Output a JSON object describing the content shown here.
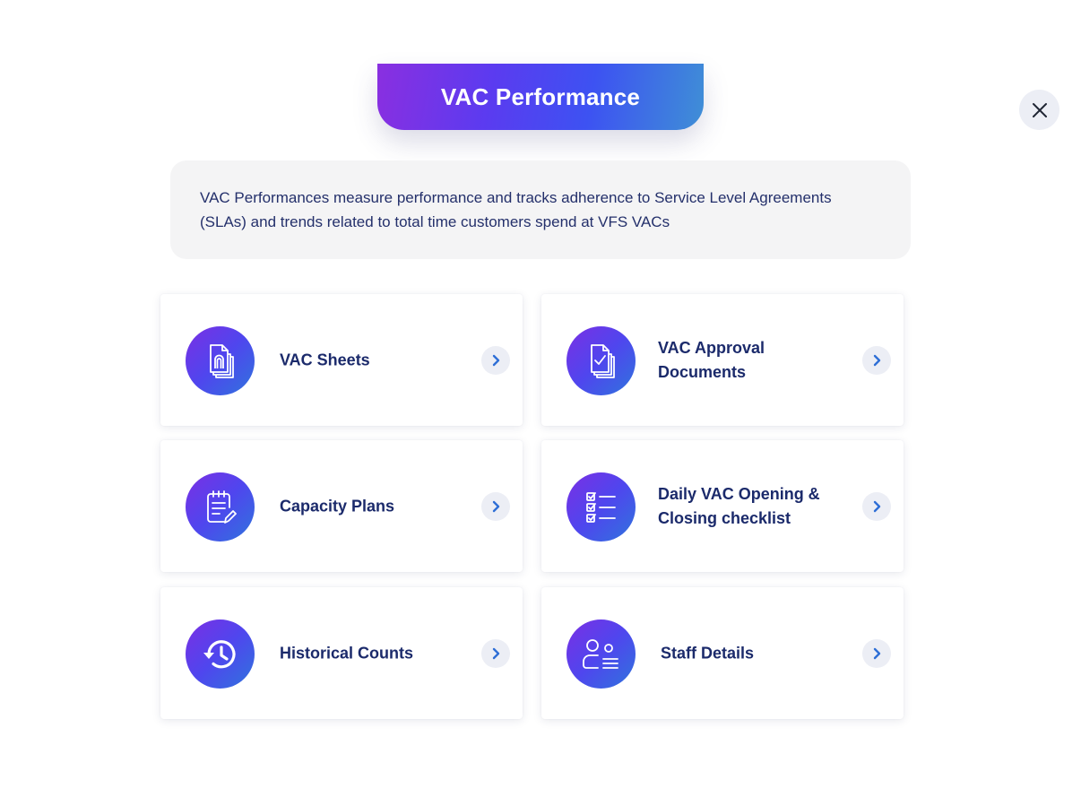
{
  "header": {
    "title": "VAC Performance"
  },
  "close": {
    "icon": "close-icon"
  },
  "description": "VAC Performances measure performance and tracks adherence to Service Level Agreements (SLAs) and trends related to total time customers spend at VFS VACs",
  "cards": [
    {
      "label": "VAC Sheets",
      "icon": "document-stack-icon"
    },
    {
      "label": "VAC Approval Documents",
      "icon": "approved-document-icon"
    },
    {
      "label": "Capacity Plans",
      "icon": "clipboard-edit-icon"
    },
    {
      "label": "Daily VAC Opening & Closing checklist",
      "icon": "checklist-icon"
    },
    {
      "label": "Historical Counts",
      "icon": "history-icon"
    },
    {
      "label": "Staff Details",
      "icon": "staff-list-icon"
    }
  ],
  "colors": {
    "accent_start": "#8a2fe0",
    "accent_mid": "#3d52f2",
    "accent_end": "#3f8fd6",
    "text_primary": "#1b2a6b",
    "chevron": "#2f6fd6"
  }
}
